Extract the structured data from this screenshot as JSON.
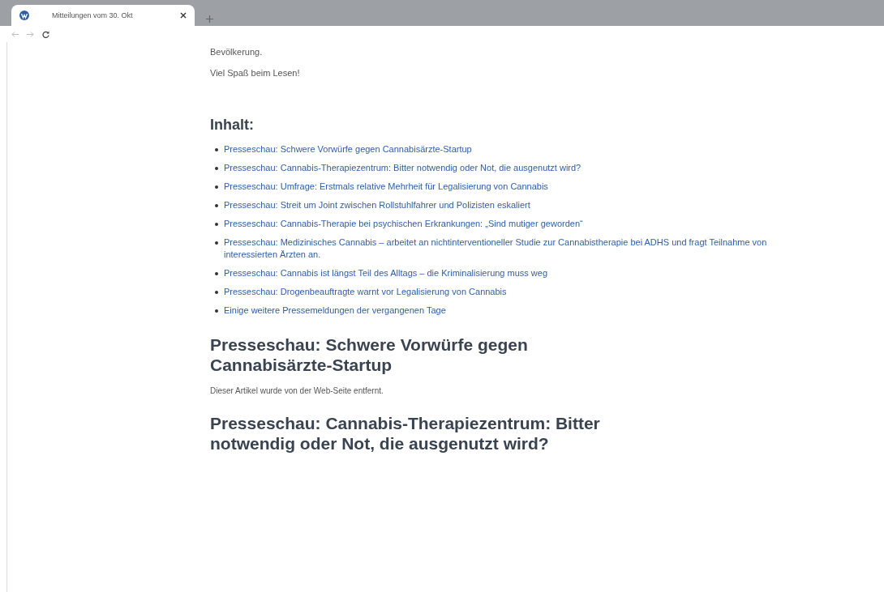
{
  "browser": {
    "tab": {
      "title": "Mitteilungen vom 30. Okt",
      "selected": true
    }
  },
  "article": {
    "paragraphs": [
      "Bevölkerung.",
      "Viel Spaß beim Lesen!"
    ],
    "toc_heading": "Inhalt:",
    "toc": [
      "Presseschau: Schwere Vorwürfe gegen Cannabisärzte-Startup",
      "Presseschau: Cannabis-Therapiezentrum: Bitter notwendig oder Not, die ausgenutzt wird?",
      "Presseschau: Umfrage: Erstmals relative Mehrheit für Legalisierung von Cannabis",
      "Presseschau: Streit um Joint zwischen Rollstuhlfahrer und Polizisten eskaliert",
      "Presseschau: Cannabis-Therapie bei psychischen Erkrankungen: „Sind mutiger geworden“",
      "Presseschau: Medizinisches Cannabis – arbeitet an nichtinterventioneller Studie zur Cannabistherapie bei ADHS und fragt Teilnahme von interessierten Ärzten an.",
      "Presseschau: Cannabis ist längst Teil des Alltags – die Kriminalisierung muss weg",
      "Presseschau: Drogenbeauftragte warnt vor Legalisierung von Cannabis",
      "Einige weitere Pressemeldungen der vergangenen Tage"
    ],
    "sections": [
      {
        "title": "Presseschau: Schwere Vorwürfe gegen Cannabisärzte-Startup",
        "body": "Dieser Artikel wurde von der Web-Seite entfernt."
      },
      {
        "title": "Presseschau: Cannabis-Therapiezentrum: Bitter notwendig oder Not, die ausgenutzt wird?"
      }
    ]
  }
}
